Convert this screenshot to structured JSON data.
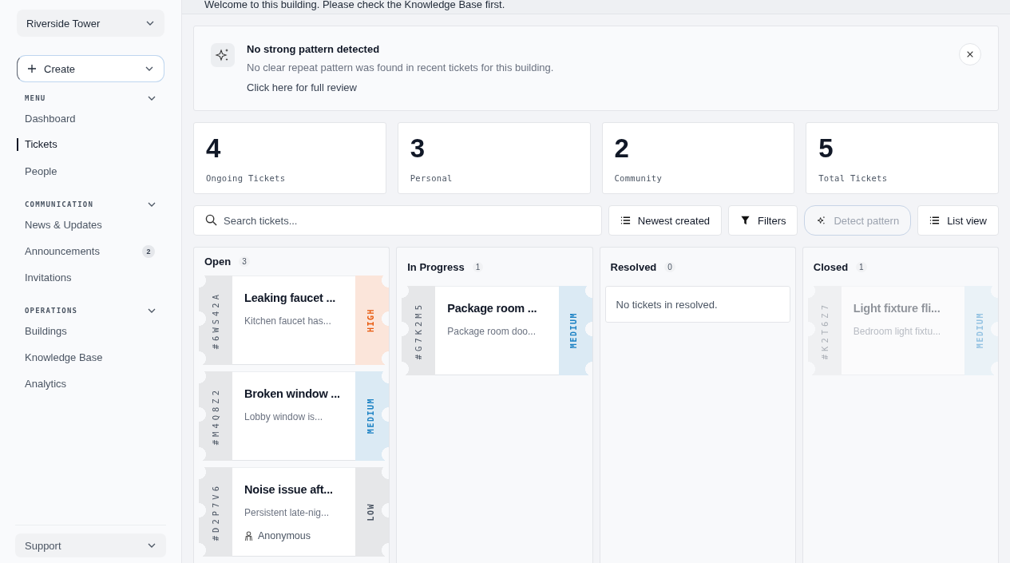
{
  "sidebar": {
    "scope": {
      "value": "Riverside Tower"
    },
    "create": {
      "label": "Create"
    },
    "sections": [
      {
        "title": "MENU",
        "expanded": true,
        "items": [
          {
            "label": "Dashboard",
            "selected": false
          },
          {
            "label": "Tickets",
            "selected": true
          },
          {
            "label": "People",
            "selected": false
          }
        ]
      },
      {
        "title": "COMMUNICATION",
        "expanded": true,
        "items": [
          {
            "label": "News & Updates",
            "selected": false
          },
          {
            "label": "Announcements",
            "selected": false,
            "badge": "2"
          },
          {
            "label": "Invitations",
            "selected": false
          }
        ]
      },
      {
        "title": "OPERATIONS",
        "expanded": true,
        "items": [
          {
            "label": "Buildings",
            "selected": false
          },
          {
            "label": "Knowledge Base",
            "selected": false
          },
          {
            "label": "Analytics",
            "selected": false
          }
        ]
      }
    ],
    "support": {
      "label": "Support"
    }
  },
  "welcome": "Welcome to this building. Please check the Knowledge Base first.",
  "insight": {
    "title": "No strong pattern detected",
    "text": "No clear repeat pattern was found in recent tickets for this building.",
    "link": "Click here for full review"
  },
  "stats": [
    {
      "value": "4",
      "label": "Ongoing Tickets"
    },
    {
      "value": "3",
      "label": "Personal"
    },
    {
      "value": "2",
      "label": "Community"
    },
    {
      "value": "5",
      "label": "Total Tickets"
    }
  ],
  "toolbar": {
    "search": {
      "placeholder": "Search tickets..."
    },
    "sort": "Newest created",
    "filters": "Filters",
    "detect": {
      "label": "Detect pattern",
      "disabled": true
    },
    "view": "List view"
  },
  "columns": [
    {
      "title": "Open",
      "count": "3",
      "tickets": [
        {
          "id": "#6WS42A",
          "title": "Leaking faucet ...",
          "summary": "Kitchen faucet has...",
          "priority": "HIGH",
          "dimmed": false
        },
        {
          "id": "#M4Q8Z2",
          "title": "Broken window ...",
          "summary": "Lobby window is...",
          "priority": "MEDIUM",
          "dimmed": false
        },
        {
          "id": "#D2P7V6",
          "title": "Noise issue aft...",
          "summary": "Persistent late-nig...",
          "priority": "LOW",
          "dimmed": false,
          "reporter": "Anonymous"
        }
      ]
    },
    {
      "title": "In Progress",
      "count": "1",
      "tickets": [
        {
          "id": "#G7K2M5",
          "title": "Package room ...",
          "summary": "Package room doo...",
          "priority": "MEDIUM",
          "dimmed": false
        }
      ]
    },
    {
      "title": "Resolved",
      "count": "0",
      "empty": "No tickets in resolved."
    },
    {
      "title": "Closed",
      "count": "1",
      "tickets": [
        {
          "id": "#K2T6Z7",
          "title": "Light fixture fli...",
          "summary": "Bedroom light fixtu...",
          "priority": "MEDIUM",
          "dimmed": true
        }
      ]
    }
  ]
}
